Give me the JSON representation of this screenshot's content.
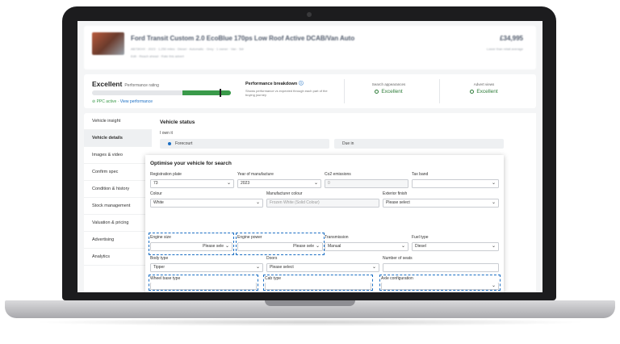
{
  "listing": {
    "title": "Ford Transit Custom 2.0 EcoBlue 170ps Low Roof Active DCAB/Van Auto",
    "sub_line_1": "AB73KHX · 2023 · 1,250 miles · Diesel · Automatic · Grey · 1 owner · Van · 5dr",
    "sub_line_2": "Edit · Reach ahead · Rate this advert",
    "price": "£34,995",
    "price_note": "Lower than retail average"
  },
  "performance": {
    "rating": "Excellent",
    "rating_label": "Performance rating",
    "bar_fill_fraction": 0.35,
    "ppc_active": "PPC active",
    "view_link": "View performance",
    "breakdown_title": "Performance breakdown",
    "breakdown_desc": "Shows performance vs expected through each part of the buying journey",
    "metrics": [
      {
        "label": "Search appearances",
        "value": "Excellent"
      },
      {
        "label": "Advert views",
        "value": "Excellent"
      }
    ]
  },
  "sidebar": {
    "items": [
      {
        "label": "Vehicle insight"
      },
      {
        "label": "Vehicle details"
      },
      {
        "label": "Images & video"
      },
      {
        "label": "Confirm spec"
      },
      {
        "label": "Condition & history"
      },
      {
        "label": "Stock management"
      },
      {
        "label": "Valuation & pricing"
      },
      {
        "label": "Advertising"
      },
      {
        "label": "Analytics"
      }
    ]
  },
  "status": {
    "title": "Vehicle status",
    "own_label": "I own it",
    "options": [
      "Forecourt",
      "Due in"
    ]
  },
  "optimise": {
    "title": "Optimise your vehicle for search",
    "fields": {
      "registration_plate": {
        "label": "Registration plate",
        "value": "73"
      },
      "year_of_manufacture": {
        "label": "Year of manufacture",
        "value": "2023"
      },
      "co2_emissions": {
        "label": "Co2 emissions",
        "value": "0"
      },
      "tax_band": {
        "label": "Tax band",
        "value": ""
      },
      "colour": {
        "label": "Colour",
        "value": "White"
      },
      "manufacturer_colour": {
        "label": "Manufacturer colour",
        "value": "Frozen White (Solid Colour)"
      },
      "exterior_finish": {
        "label": "Exterior finish",
        "value": "Please select"
      },
      "engine_size": {
        "label": "Engine size",
        "unit": "Please sele"
      },
      "engine_power": {
        "label": "Engine power",
        "unit": "Please sele"
      },
      "transmission": {
        "label": "Transmission",
        "value": "Manual"
      },
      "fuel_type": {
        "label": "Fuel type",
        "value": "Diesel"
      },
      "body_type": {
        "label": "Body type",
        "value": "Tipper"
      },
      "doors": {
        "label": "Doors",
        "value": "Please select"
      },
      "number_of_seats": {
        "label": "Number of seats",
        "value": ""
      },
      "wheel_base_type": {
        "label": "Wheel base type",
        "value": ""
      },
      "cab_type": {
        "label": "Cab type",
        "value": ""
      },
      "axle_configuration": {
        "label": "Axle configuration",
        "value": ""
      }
    }
  },
  "colors": {
    "accent": "#1c6fc4",
    "good": "#3a9a4a",
    "frame": "#1c1c1e"
  }
}
